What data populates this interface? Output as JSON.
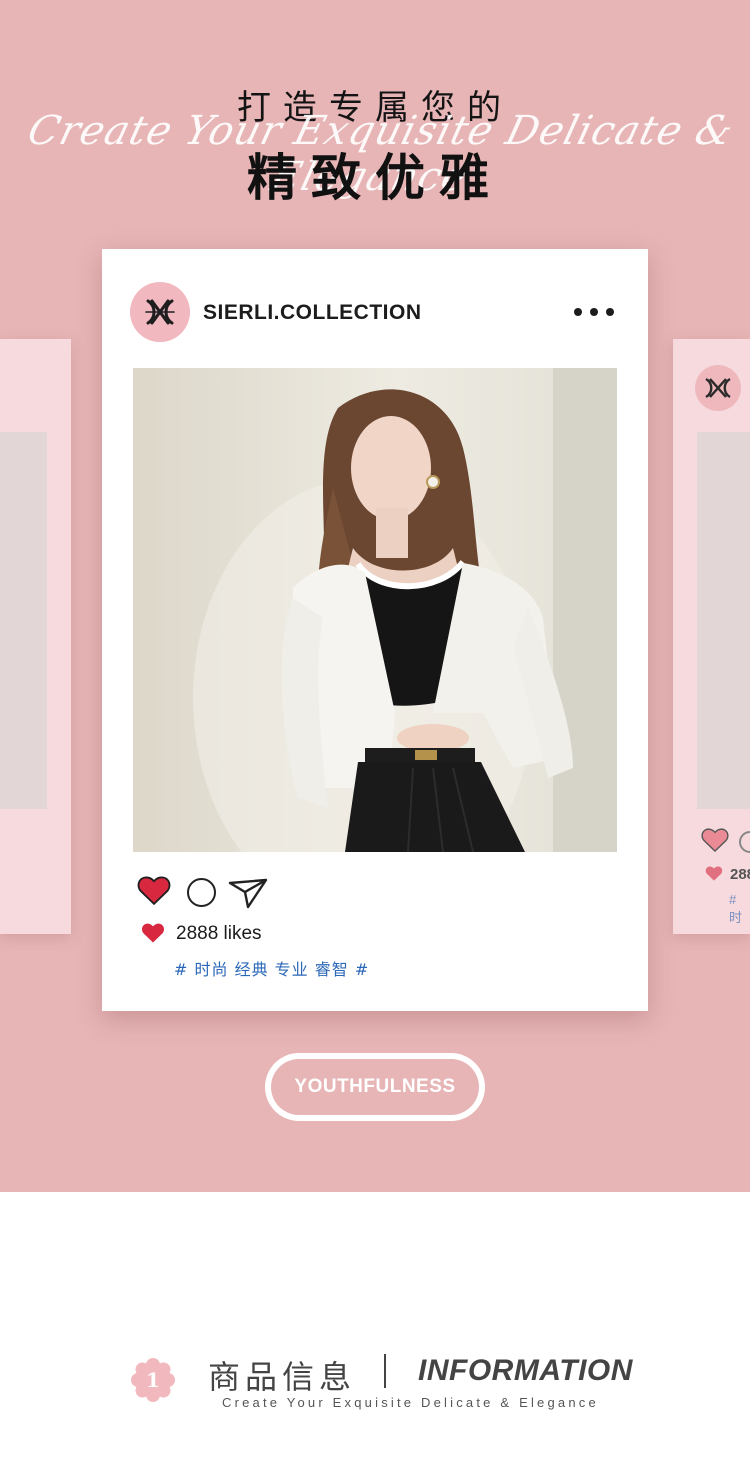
{
  "header": {
    "line1": "打造专属您的",
    "script": "Create Your Exquisite Delicate & Elegance",
    "line2": "精致优雅"
  },
  "post": {
    "account_name": "SIERLI.COLLECTION",
    "likes_text": "2888 likes",
    "tags": "# 时尚 经典 专业 睿智 #"
  },
  "side_card_right": {
    "likes_partial": "288",
    "tag_partial": "# 时"
  },
  "button": {
    "label": "YOUTHFULNESS"
  },
  "info": {
    "number": "1",
    "title_cn": "商品信息",
    "title_en": "INFORMATION",
    "subtitle": "Create Your Exquisite Delicate & Elegance"
  },
  "colors": {
    "background_pink": "#e7b5b6",
    "card_pink": "#f7dadd",
    "heart_red": "#d8283f",
    "tag_blue": "#2c68b8"
  },
  "icons": [
    "brand-logo-icon",
    "more-dots-icon",
    "heart-icon",
    "comment-icon",
    "share-icon",
    "flower-badge-icon"
  ]
}
